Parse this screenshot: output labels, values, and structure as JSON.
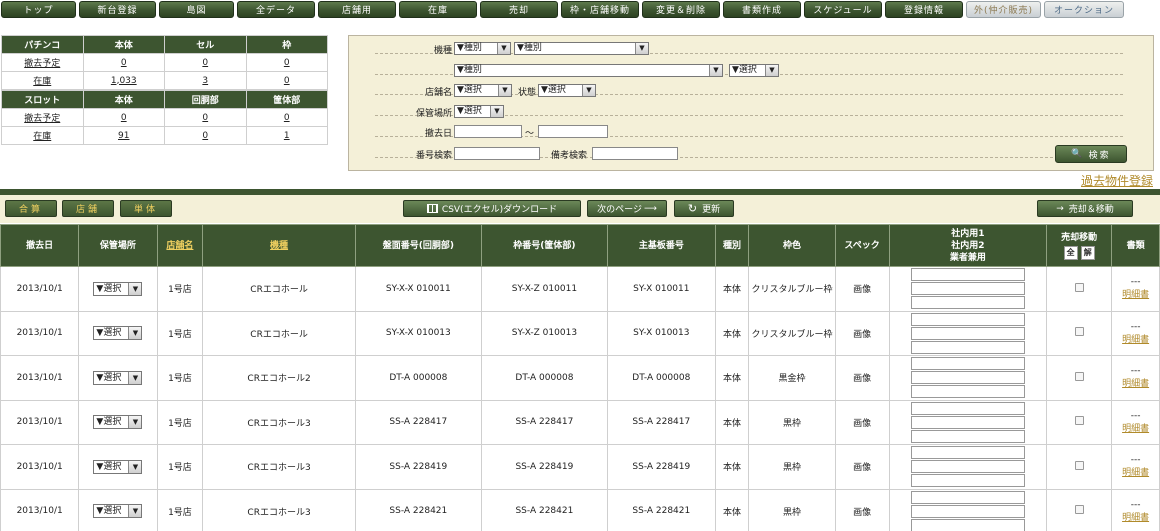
{
  "nav": [
    {
      "label": "トップ",
      "style": "dark"
    },
    {
      "label": "新台登録",
      "style": "dark"
    },
    {
      "label": "島図",
      "style": "dark"
    },
    {
      "label": "全データ",
      "style": "dark"
    },
    {
      "label": "店舗用",
      "style": "dark"
    },
    {
      "label": "在庫",
      "style": "dark"
    },
    {
      "label": "売却",
      "style": "dark"
    },
    {
      "label": "枠・店舗移動",
      "style": "dark"
    },
    {
      "label": "変更＆削除",
      "style": "dark"
    },
    {
      "label": "書類作成",
      "style": "dark"
    },
    {
      "label": "スケジュール",
      "style": "dark"
    },
    {
      "label": "登録情報",
      "style": "dark"
    },
    {
      "label": "外(仲介販売)",
      "style": "light"
    },
    {
      "label": "オークション",
      "style": "light-blue"
    }
  ],
  "summary": {
    "pachinko": {
      "headers": [
        "パチンコ",
        "本体",
        "セル",
        "枠"
      ],
      "rows": [
        {
          "label": "撤去予定",
          "values": [
            "0",
            "0",
            "0"
          ]
        },
        {
          "label": "在庫",
          "values": [
            "1,033",
            "3",
            "0"
          ]
        }
      ]
    },
    "slot": {
      "headers": [
        "スロット",
        "本体",
        "回胴部",
        "筐体部"
      ],
      "rows": [
        {
          "label": "撤去予定",
          "values": [
            "0",
            "0",
            "0"
          ]
        },
        {
          "label": "在庫",
          "values": [
            "91",
            "0",
            "1"
          ]
        }
      ]
    }
  },
  "search": {
    "model_label": "機種",
    "type_select_1": "▼種別",
    "type_select_2": "▼種別",
    "type_select_3": "▼種別",
    "choose_select_a": "▼選択",
    "store_label": "店舗名",
    "store_select": "▼選択",
    "state_label": "状態",
    "state_select": "▼選択",
    "storage_label": "保管場所",
    "storage_select": "▼選択",
    "removal_label": "撤去日",
    "range_sep": "～",
    "number_label": "番号検索",
    "note_label": "備考検索",
    "search_button": "検索"
  },
  "past_link": "過去物件登録",
  "toolbar": {
    "total": "合算",
    "store": "店舗",
    "single": "単体",
    "csv": "CSV(エクセル)ダウンロード",
    "next_page": "次のページ",
    "refresh": "更新",
    "sell_move": "売却＆移動"
  },
  "table": {
    "headers": {
      "removal_date": "撤去日",
      "storage": "保管場所",
      "store_name": "店舗名",
      "model": "機種",
      "board_no": "盤面番号(回胴部)",
      "frame_no": "枠番号(筐体部)",
      "main_no": "主基板番号",
      "kind": "種別",
      "frame_color": "枠色",
      "spec": "スペック",
      "memo_1": "社内用1",
      "memo_2": "社内用2",
      "memo_3": "業者兼用",
      "sell_move": "売却移動",
      "all": "全",
      "release": "解",
      "docs": "書類"
    },
    "rows": [
      {
        "date": "2013/10/1",
        "storage": "▼選択",
        "store": "1号店",
        "model": "CRエコホール",
        "board": "SY-X-X 010011",
        "frame": "SY-X-Z 010011",
        "main": "SY-X 010011",
        "kind": "本体",
        "color": "クリスタルブルー枠",
        "spec": "画像",
        "doc_dash": "---",
        "doc_link": "明細書"
      },
      {
        "date": "2013/10/1",
        "storage": "▼選択",
        "store": "1号店",
        "model": "CRエコホール",
        "board": "SY-X-X 010013",
        "frame": "SY-X-Z 010013",
        "main": "SY-X 010013",
        "kind": "本体",
        "color": "クリスタルブルー枠",
        "spec": "画像",
        "doc_dash": "---",
        "doc_link": "明細書"
      },
      {
        "date": "2013/10/1",
        "storage": "▼選択",
        "store": "1号店",
        "model": "CRエコホール2",
        "board": "DT-A 000008",
        "frame": "DT-A 000008",
        "main": "DT-A 000008",
        "kind": "本体",
        "color": "黒金枠",
        "spec": "画像",
        "doc_dash": "---",
        "doc_link": "明細書"
      },
      {
        "date": "2013/10/1",
        "storage": "▼選択",
        "store": "1号店",
        "model": "CRエコホール3",
        "board": "SS-A 228417",
        "frame": "SS-A 228417",
        "main": "SS-A 228417",
        "kind": "本体",
        "color": "黒枠",
        "spec": "画像",
        "doc_dash": "---",
        "doc_link": "明細書"
      },
      {
        "date": "2013/10/1",
        "storage": "▼選択",
        "store": "1号店",
        "model": "CRエコホール3",
        "board": "SS-A 228419",
        "frame": "SS-A 228419",
        "main": "SS-A 228419",
        "kind": "本体",
        "color": "黒枠",
        "spec": "画像",
        "doc_dash": "---",
        "doc_link": "明細書"
      },
      {
        "date": "2013/10/1",
        "storage": "▼選択",
        "store": "1号店",
        "model": "CRエコホール3",
        "board": "SS-A 228421",
        "frame": "SS-A 228421",
        "main": "SS-A 228421",
        "kind": "本体",
        "color": "黒枠",
        "spec": "画像",
        "doc_dash": "---",
        "doc_link": "明細書"
      }
    ]
  },
  "colors": {
    "brand_green": "#3d5530",
    "panel_beige": "#f4f0d8",
    "link_gold": "#b08a2a"
  }
}
